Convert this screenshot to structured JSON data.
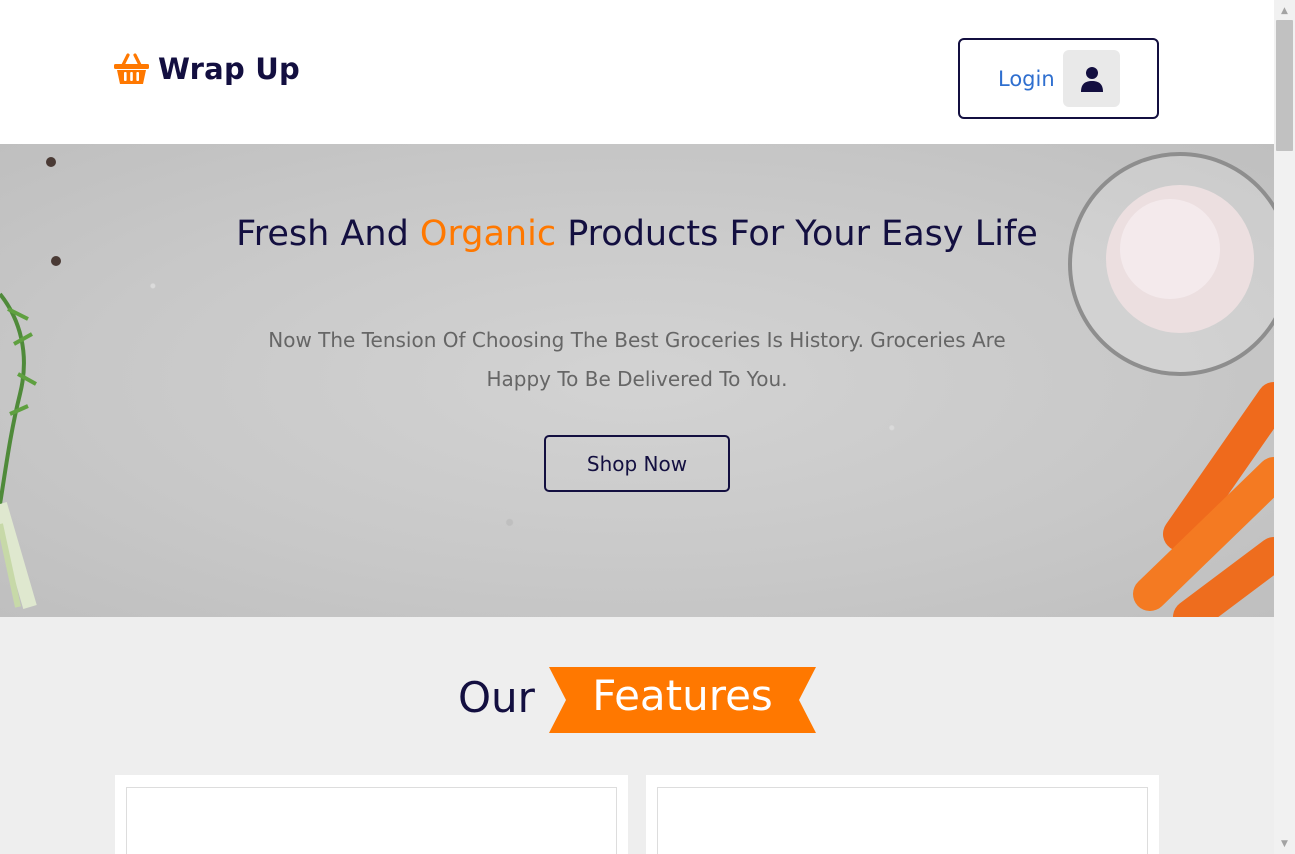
{
  "header": {
    "brand": "Wrap Up",
    "login_label": "Login"
  },
  "hero": {
    "title_part1": "Fresh And ",
    "title_accent": "Organic",
    "title_part2": " Products For Your Easy Life",
    "subtitle": "Now The Tension Of Choosing The Best Groceries Is History. Groceries Are Happy To Be Delivered To You.",
    "cta_label": "Shop Now"
  },
  "features": {
    "heading_plain": "Our",
    "heading_highlight": "Features",
    "cards": [
      {
        "title": ""
      },
      {
        "title": ""
      }
    ]
  },
  "colors": {
    "brand_dark": "#130f40",
    "accent": "#ff7800",
    "login_text": "#2f6fcf"
  },
  "icons": [
    "basket-icon",
    "user-icon",
    "scroll-up-icon",
    "scroll-down-icon"
  ]
}
